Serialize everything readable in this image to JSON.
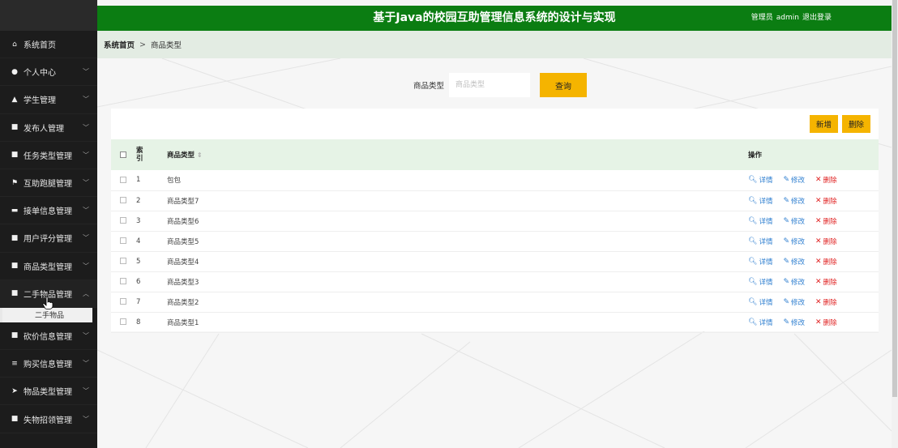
{
  "header": {
    "title": "基于Java的校园互助管理信息系统的设计与实现",
    "user_role": "管理员",
    "username": "admin",
    "logout": "退出登录"
  },
  "breadcrumb": {
    "home": "系统首页",
    "separator": ">",
    "current": "商品类型"
  },
  "sidebar": {
    "items": [
      {
        "label": "系统首页",
        "icon": "home-icon"
      },
      {
        "label": "个人中心",
        "icon": "user-icon"
      },
      {
        "label": "学生管理",
        "icon": "student-icon"
      },
      {
        "label": "发布人管理",
        "icon": "grid-icon"
      },
      {
        "label": "任务类型管理",
        "icon": "grid-icon"
      },
      {
        "label": "互助跑腿管理",
        "icon": "flag-icon"
      },
      {
        "label": "接单信息管理",
        "icon": "ticket-icon"
      },
      {
        "label": "用户评分管理",
        "icon": "grid-icon"
      },
      {
        "label": "商品类型管理",
        "icon": "grid-icon"
      },
      {
        "label": "二手物品管理",
        "icon": "grid-icon"
      },
      {
        "label": "砍价信息管理",
        "icon": "grid-icon"
      },
      {
        "label": "购买信息管理",
        "icon": "list-icon"
      },
      {
        "label": "物品类型管理",
        "icon": "send-icon"
      },
      {
        "label": "失物招领管理",
        "icon": "grid-icon"
      }
    ],
    "submenu_label": "二手物品"
  },
  "search": {
    "label": "商品类型",
    "placeholder": "商品类型",
    "button": "查询"
  },
  "toolbar": {
    "add": "新增",
    "delete": "删除"
  },
  "table": {
    "columns": {
      "index": "索引",
      "name": "商品类型",
      "actions": "操作"
    },
    "actions": {
      "view": "详情",
      "edit": "修改",
      "delete": "删除"
    },
    "rows": [
      {
        "index": "1",
        "name": "包包"
      },
      {
        "index": "2",
        "name": "商品类型7"
      },
      {
        "index": "3",
        "name": "商品类型6"
      },
      {
        "index": "4",
        "name": "商品类型5"
      },
      {
        "index": "5",
        "name": "商品类型4"
      },
      {
        "index": "6",
        "name": "商品类型3"
      },
      {
        "index": "7",
        "name": "商品类型2"
      },
      {
        "index": "8",
        "name": "商品类型1"
      }
    ]
  },
  "colors": {
    "header_green": "#0b7d12",
    "sidebar_dark": "#1c1c1c",
    "accent_yellow": "#f5b400",
    "table_head_bg": "#e6f3e6",
    "link_blue": "#2f7fd0",
    "delete_red": "#e02020"
  }
}
